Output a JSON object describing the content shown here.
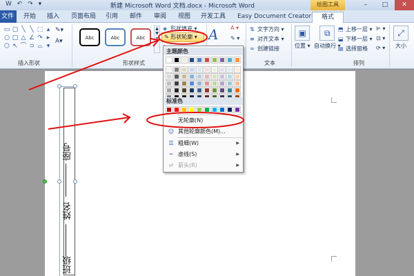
{
  "window": {
    "title": "新建 Microsoft Word 文档.docx - Microsoft Word",
    "context_group": "绘图工具",
    "controls": [
      "–",
      "□",
      "✕"
    ]
  },
  "quick_access": [
    "W",
    "↶",
    "↷",
    "▾"
  ],
  "tabs": [
    "文件",
    "开始",
    "插入",
    "页面布局",
    "引用",
    "邮件",
    "审阅",
    "视图",
    "开发工具",
    "Easy Document Creator",
    "格式"
  ],
  "ribbon": {
    "insert_shapes": {
      "label": "插入形状",
      "icons": [
        "▭",
        "▢",
        "╲",
        "╲",
        "⬚",
        "▴",
        "○",
        "□",
        "△",
        "∠",
        "↷",
        "▸",
        "⬡",
        "↖",
        "⌒",
        "⊃",
        "⌓",
        "▾"
      ],
      "edit_shape": "✎▾",
      "text_box": "A▾"
    },
    "shape_styles": {
      "label": "形状样式",
      "gallery": [
        "Abc",
        "Abc",
        "Abc"
      ],
      "gallery_colors": [
        "#000000",
        "#4f81bd",
        "#c0504d"
      ],
      "fill": "形状填充",
      "outline": "形状轮廓",
      "effects_icon": "✎"
    },
    "wordart": {
      "label": "艺",
      "glyph": "A"
    },
    "text": {
      "label": "文本",
      "direction": "文字方向",
      "align": "对齐文本",
      "link": "创建链接"
    },
    "arrange": {
      "label": "排列",
      "position": "位置",
      "wrap": "自动换行",
      "bring_forward": "上移一层",
      "send_backward": "下移一层",
      "selection_pane": "选择窗格"
    },
    "size": {
      "label": "大小"
    }
  },
  "document": {
    "textbox_texts": [
      "班级",
      "姓名",
      "座号"
    ]
  },
  "dropdown": {
    "theme_header": "主题颜色",
    "standard_header": "标准色",
    "theme_base": [
      "#ffffff",
      "#000000",
      "#eeece1",
      "#1f497d",
      "#4f81bd",
      "#c0504d",
      "#9bbb59",
      "#8064a2",
      "#4bacc6",
      "#f79646"
    ],
    "theme_shades": [
      [
        "#f2f2f2",
        "#7f7f7f",
        "#ddd9c3",
        "#c6d9f0",
        "#dbe5f1",
        "#f2dcdb",
        "#ebf1dd",
        "#e5e0ec",
        "#dbeef3",
        "#fdeada"
      ],
      [
        "#d8d8d8",
        "#595959",
        "#c4bd97",
        "#8db3e2",
        "#b8cce4",
        "#e5b9b7",
        "#d7e3bc",
        "#ccc1d9",
        "#b7dde8",
        "#fbd5b5"
      ],
      [
        "#bfbfbf",
        "#3f3f3f",
        "#938953",
        "#548dd4",
        "#95b3d7",
        "#d99694",
        "#c3d69b",
        "#b2a2c7",
        "#92cddc",
        "#fac08f"
      ],
      [
        "#a5a5a5",
        "#262626",
        "#494429",
        "#17365d",
        "#366092",
        "#953734",
        "#76923c",
        "#5f497a",
        "#31859b",
        "#e36c09"
      ],
      [
        "#7f7f7f",
        "#0c0c0c",
        "#1d1b10",
        "#0f243e",
        "#244061",
        "#632423",
        "#4f6128",
        "#3f3151",
        "#205867",
        "#974806"
      ]
    ],
    "standard": [
      "#c00000",
      "#ff0000",
      "#ffc000",
      "#ffff00",
      "#92d050",
      "#00b050",
      "#00b0f0",
      "#0070c0",
      "#002060",
      "#7030a0"
    ],
    "no_outline": "无轮廓(N)",
    "more_colors": "其他轮廓颜色(M)...",
    "weight": "粗细(W)",
    "dashes": "虚线(S)",
    "arrows": "箭头(R)"
  },
  "annotation_color": "#e01010"
}
